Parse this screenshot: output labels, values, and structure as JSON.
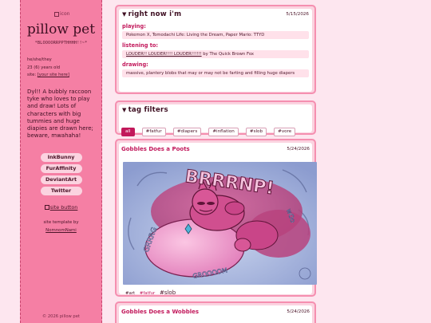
{
  "sidebar": {
    "icon_alt": "icon",
    "title": "pillow pet",
    "subtitle": "*BLOOOORRPPTHHHH!!~*",
    "pronouns": "he/she/they",
    "age": "23 (6) years old",
    "site_label": "site:",
    "site_link": "[your site here]",
    "bio": "Dyl!! A bubbly raccoon tyke who loves to play and draw! Lots of characters with big tummies and huge diapies are drawn here; beware, mwahaha!",
    "links": [
      "InkBunny",
      "FurAffinity",
      "DeviantArt",
      "Twitter"
    ],
    "site_button_alt": "site button",
    "template_text": "site template by",
    "template_author": "NomnomNami",
    "copyright": "© 2026 pillow pet"
  },
  "now": {
    "heading": "right now i'm",
    "date": "5/15/2026",
    "playing_label": "playing:",
    "playing": "Pokemon X, Tomodachi Life: Living the Dream, Paper Mario: TTYD",
    "listening_label": "listening to:",
    "listening_track": "LOUDER!! LOUDER!!!! LOUDER!!!!!!",
    "listening_by": " by The Quick Brown Fox",
    "drawing_label": "drawing:",
    "drawing": "massive, plantery blobs that may or may not be farting and filling huge diapers"
  },
  "tag_filters": {
    "heading": "tag filters",
    "tags": [
      "all",
      "#fatfur",
      "#diapers",
      "#inflation",
      "#slob",
      "#vore"
    ],
    "active": "all"
  },
  "posts": [
    {
      "title": "Gobbles Does a Poots",
      "date": "5/24/2026",
      "image_caption_text": "BRRRNP",
      "sfx": [
        "GRRRG",
        "GRRLP",
        "wOo",
        "GROOOOM"
      ],
      "tags": [
        "#art",
        "#fatfur",
        "#slob"
      ]
    },
    {
      "title": "Gobbles Does a Wobbles",
      "date": "5/24/2026"
    }
  ],
  "colors": {
    "sidebar": "#f57fa4",
    "accent": "#c2185b",
    "card_border": "#f58fb0",
    "background": "#fde6ef"
  }
}
